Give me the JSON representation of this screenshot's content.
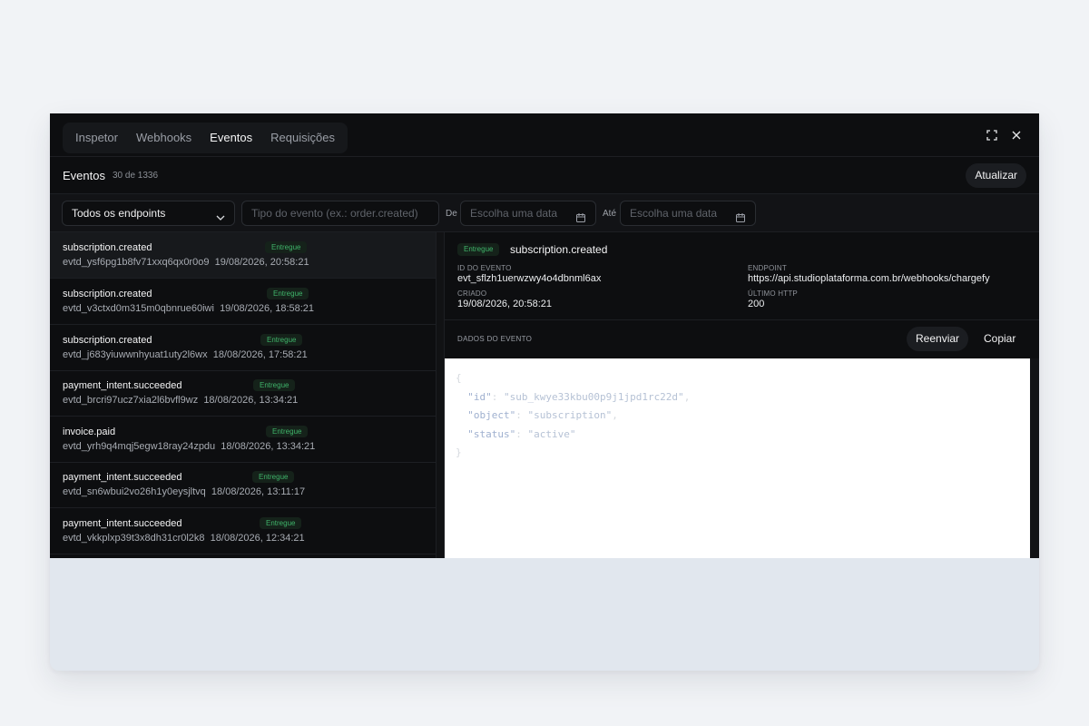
{
  "tabs": [
    {
      "label": "Inspetor"
    },
    {
      "label": "Webhooks"
    },
    {
      "label": "Eventos",
      "active": true
    },
    {
      "label": "Requisições"
    }
  ],
  "header": {
    "title": "Eventos",
    "count": "30 de 1336",
    "refresh_label": "Atualizar"
  },
  "filters": {
    "endpoint_select": "Todos os endpoints",
    "event_type_placeholder": "Tipo do evento (ex.: order.created)",
    "from_label": "De",
    "from_placeholder": "Escolha uma data",
    "to_label": "Até",
    "to_placeholder": "Escolha uma data"
  },
  "events": [
    {
      "name": "subscription.created",
      "id": "evtd_ysf6pg1b8fv71xxq6qx0r0o9",
      "date": "19/08/2026, 20:58:21",
      "status": "Entregue"
    },
    {
      "name": "subscription.created",
      "id": "evtd_v3ctxd0m315m0qbnrue60iwi",
      "date": "19/08/2026, 18:58:21",
      "status": "Entregue"
    },
    {
      "name": "subscription.created",
      "id": "evtd_j683yiuwwnhyuat1uty2l6wx",
      "date": "18/08/2026, 17:58:21",
      "status": "Entregue"
    },
    {
      "name": "payment_intent.succeeded",
      "id": "evtd_brcri97ucz7xia2l6bvfl9wz",
      "date": "18/08/2026, 13:34:21",
      "status": "Entregue"
    },
    {
      "name": "invoice.paid",
      "id": "evtd_yrh9q4mqj5egw18ray24zpdu",
      "date": "18/08/2026, 13:34:21",
      "status": "Entregue"
    },
    {
      "name": "payment_intent.succeeded",
      "id": "evtd_sn6wbui2vo26h1y0eysjltvq",
      "date": "18/08/2026, 13:11:17",
      "status": "Entregue"
    },
    {
      "name": "payment_intent.succeeded",
      "id": "evtd_vkkplxp39t3x8dh31cr0l2k8",
      "date": "18/08/2026, 12:34:21",
      "status": "Entregue"
    }
  ],
  "detail": {
    "status": "Entregue",
    "title": "subscription.created",
    "event_id_label": "ID DO EVENTO",
    "event_id": "evt_sflzh1uerwzwy4o4dbnml6ax",
    "endpoint_label": "ENDPOINT",
    "endpoint": "https://api.studioplataforma.com.br/webhooks/chargefy",
    "created_label": "CRIADO",
    "created": "19/08/2026, 20:58:21",
    "http_label": "ÚLTIMO HTTP",
    "http": "200",
    "section_label": "DADOS DO EVENTO",
    "resend_label": "Reenviar",
    "copy_label": "Copiar",
    "payload": {
      "open": "{",
      "id_key": "\"id\"",
      "id_val": "\"sub_kwye33kbu00p9j1jpd1rc22d\"",
      "object_key": "\"object\"",
      "object_val": "\"subscription\"",
      "status_key": "\"status\"",
      "status_val": "\"active\"",
      "close": "}"
    }
  },
  "colors": {
    "panel_bg": "#0d0e10",
    "badge_text": "#3fb46a",
    "badge_bg": "#15221a"
  }
}
